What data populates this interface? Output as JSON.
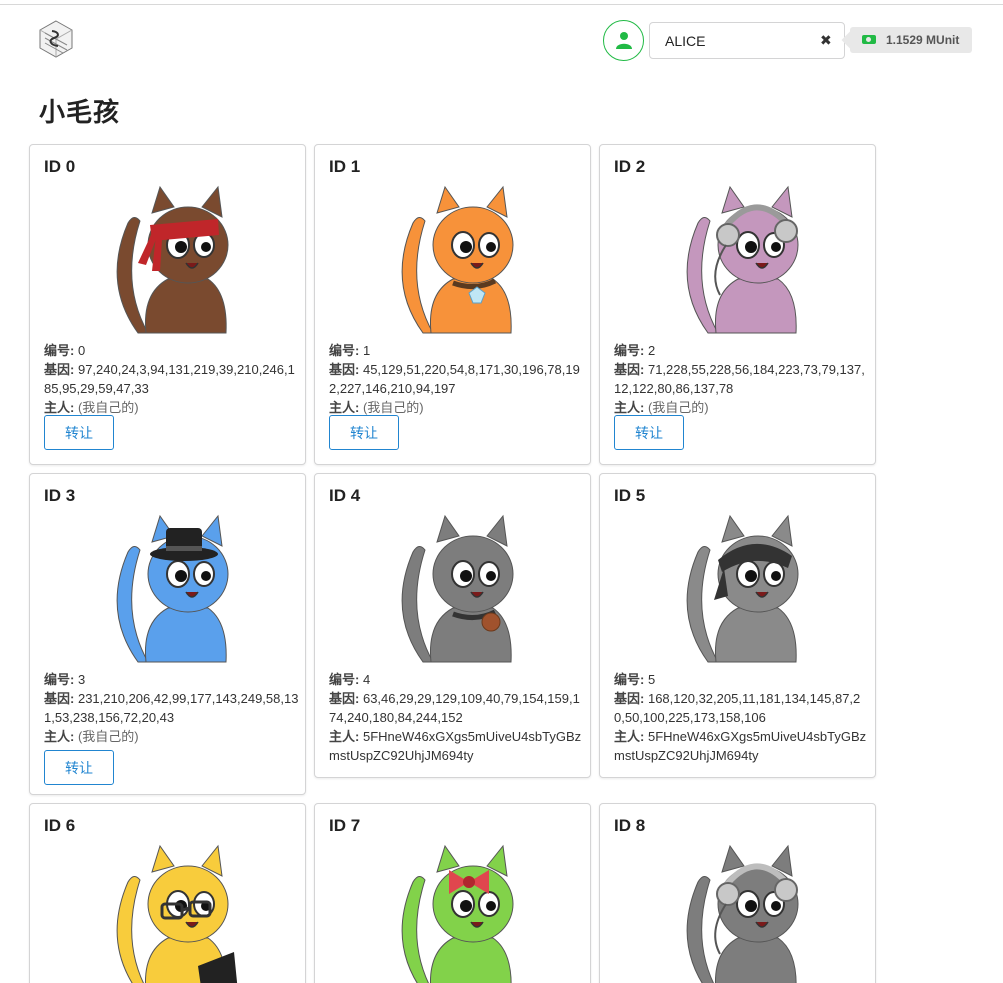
{
  "header": {
    "account_name": "ALICE",
    "clear_symbol": "✖",
    "balance": "1.1529 MUnit"
  },
  "page_title": "小毛孩",
  "labels": {
    "number": "编号:",
    "genes": "基因:",
    "owner": "主人:",
    "transfer": "转让"
  },
  "kitties": [
    {
      "id": "ID 0",
      "number": "0",
      "genes": "97,240,24,3,94,131,219,39,210,246,185,95,29,59,47,33",
      "owner": "(我自己的)",
      "own": true,
      "body_color": "#7a4a2f",
      "accent_color": "#c0262a",
      "accessory": "headband-icon"
    },
    {
      "id": "ID 1",
      "number": "1",
      "genes": "45,129,51,220,54,8,171,30,196,78,192,227,146,210,94,197",
      "owner": "(我自己的)",
      "own": true,
      "body_color": "#f7923a",
      "accent_color": "#5a3a20",
      "accessory": "diamond-collar-icon"
    },
    {
      "id": "ID 2",
      "number": "2",
      "genes": "71,228,55,228,56,184,223,73,79,137,12,122,80,86,137,78",
      "owner": "(我自己的)",
      "own": true,
      "body_color": "#c497bd",
      "accent_color": "#9a9a9a",
      "accessory": "headphones-icon"
    },
    {
      "id": "ID 3",
      "number": "3",
      "genes": "231,210,206,42,99,177,143,249,58,131,53,238,156,72,20,43",
      "owner": "(我自己的)",
      "own": true,
      "body_color": "#5aa0ec",
      "accent_color": "#222222",
      "accessory": "top-hat-icon"
    },
    {
      "id": "ID 4",
      "number": "4",
      "genes": "63,46,29,29,129,109,40,79,154,159,174,240,180,84,244,152",
      "owner": "5FHneW46xGXgs5mUiveU4sbTyGBzmstUspZC92UhjJM694ty",
      "own": false,
      "body_color": "#7d7d7d",
      "accent_color": "#a0522d",
      "accessory": "coin-collar-icon"
    },
    {
      "id": "ID 5",
      "number": "5",
      "genes": "168,120,32,205,11,181,134,145,87,20,50,100,225,173,158,106",
      "owner": "5FHneW46xGXgs5mUiveU4sbTyGBzmstUspZC92UhjJM694ty",
      "own": false,
      "body_color": "#8a8a8a",
      "accent_color": "#333333",
      "accessory": "bandana-icon"
    },
    {
      "id": "ID 6",
      "number": "",
      "genes": "",
      "owner": "",
      "own": false,
      "body_color": "#f8cc3c",
      "accent_color": "#333333",
      "accessory": "glasses-laptop-icon"
    },
    {
      "id": "ID 7",
      "number": "",
      "genes": "",
      "owner": "",
      "own": false,
      "body_color": "#82d24a",
      "accent_color": "#e0464e",
      "accessory": "bow-icon"
    },
    {
      "id": "ID 8",
      "number": "",
      "genes": "",
      "owner": "",
      "own": false,
      "body_color": "#7d7d7d",
      "accent_color": "#bdbdbd",
      "accessory": "headphones-icon"
    }
  ]
}
